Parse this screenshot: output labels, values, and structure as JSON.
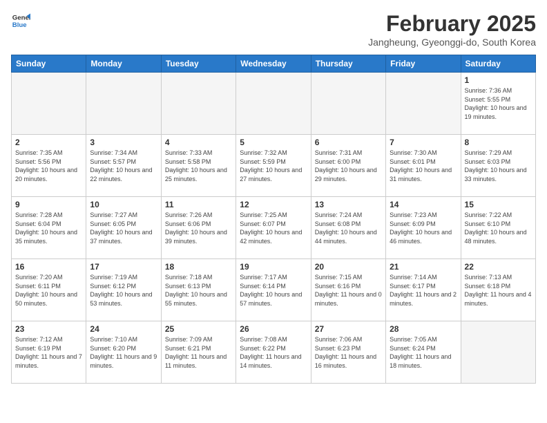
{
  "logo": {
    "general": "General",
    "blue": "Blue"
  },
  "title": "February 2025",
  "subtitle": "Jangheung, Gyeonggi-do, South Korea",
  "headers": [
    "Sunday",
    "Monday",
    "Tuesday",
    "Wednesday",
    "Thursday",
    "Friday",
    "Saturday"
  ],
  "weeks": [
    [
      {
        "day": "",
        "info": ""
      },
      {
        "day": "",
        "info": ""
      },
      {
        "day": "",
        "info": ""
      },
      {
        "day": "",
        "info": ""
      },
      {
        "day": "",
        "info": ""
      },
      {
        "day": "",
        "info": ""
      },
      {
        "day": "1",
        "info": "Sunrise: 7:36 AM\nSunset: 5:55 PM\nDaylight: 10 hours and 19 minutes."
      }
    ],
    [
      {
        "day": "2",
        "info": "Sunrise: 7:35 AM\nSunset: 5:56 PM\nDaylight: 10 hours and 20 minutes."
      },
      {
        "day": "3",
        "info": "Sunrise: 7:34 AM\nSunset: 5:57 PM\nDaylight: 10 hours and 22 minutes."
      },
      {
        "day": "4",
        "info": "Sunrise: 7:33 AM\nSunset: 5:58 PM\nDaylight: 10 hours and 25 minutes."
      },
      {
        "day": "5",
        "info": "Sunrise: 7:32 AM\nSunset: 5:59 PM\nDaylight: 10 hours and 27 minutes."
      },
      {
        "day": "6",
        "info": "Sunrise: 7:31 AM\nSunset: 6:00 PM\nDaylight: 10 hours and 29 minutes."
      },
      {
        "day": "7",
        "info": "Sunrise: 7:30 AM\nSunset: 6:01 PM\nDaylight: 10 hours and 31 minutes."
      },
      {
        "day": "8",
        "info": "Sunrise: 7:29 AM\nSunset: 6:03 PM\nDaylight: 10 hours and 33 minutes."
      }
    ],
    [
      {
        "day": "9",
        "info": "Sunrise: 7:28 AM\nSunset: 6:04 PM\nDaylight: 10 hours and 35 minutes."
      },
      {
        "day": "10",
        "info": "Sunrise: 7:27 AM\nSunset: 6:05 PM\nDaylight: 10 hours and 37 minutes."
      },
      {
        "day": "11",
        "info": "Sunrise: 7:26 AM\nSunset: 6:06 PM\nDaylight: 10 hours and 39 minutes."
      },
      {
        "day": "12",
        "info": "Sunrise: 7:25 AM\nSunset: 6:07 PM\nDaylight: 10 hours and 42 minutes."
      },
      {
        "day": "13",
        "info": "Sunrise: 7:24 AM\nSunset: 6:08 PM\nDaylight: 10 hours and 44 minutes."
      },
      {
        "day": "14",
        "info": "Sunrise: 7:23 AM\nSunset: 6:09 PM\nDaylight: 10 hours and 46 minutes."
      },
      {
        "day": "15",
        "info": "Sunrise: 7:22 AM\nSunset: 6:10 PM\nDaylight: 10 hours and 48 minutes."
      }
    ],
    [
      {
        "day": "16",
        "info": "Sunrise: 7:20 AM\nSunset: 6:11 PM\nDaylight: 10 hours and 50 minutes."
      },
      {
        "day": "17",
        "info": "Sunrise: 7:19 AM\nSunset: 6:12 PM\nDaylight: 10 hours and 53 minutes."
      },
      {
        "day": "18",
        "info": "Sunrise: 7:18 AM\nSunset: 6:13 PM\nDaylight: 10 hours and 55 minutes."
      },
      {
        "day": "19",
        "info": "Sunrise: 7:17 AM\nSunset: 6:14 PM\nDaylight: 10 hours and 57 minutes."
      },
      {
        "day": "20",
        "info": "Sunrise: 7:15 AM\nSunset: 6:16 PM\nDaylight: 11 hours and 0 minutes."
      },
      {
        "day": "21",
        "info": "Sunrise: 7:14 AM\nSunset: 6:17 PM\nDaylight: 11 hours and 2 minutes."
      },
      {
        "day": "22",
        "info": "Sunrise: 7:13 AM\nSunset: 6:18 PM\nDaylight: 11 hours and 4 minutes."
      }
    ],
    [
      {
        "day": "23",
        "info": "Sunrise: 7:12 AM\nSunset: 6:19 PM\nDaylight: 11 hours and 7 minutes."
      },
      {
        "day": "24",
        "info": "Sunrise: 7:10 AM\nSunset: 6:20 PM\nDaylight: 11 hours and 9 minutes."
      },
      {
        "day": "25",
        "info": "Sunrise: 7:09 AM\nSunset: 6:21 PM\nDaylight: 11 hours and 11 minutes."
      },
      {
        "day": "26",
        "info": "Sunrise: 7:08 AM\nSunset: 6:22 PM\nDaylight: 11 hours and 14 minutes."
      },
      {
        "day": "27",
        "info": "Sunrise: 7:06 AM\nSunset: 6:23 PM\nDaylight: 11 hours and 16 minutes."
      },
      {
        "day": "28",
        "info": "Sunrise: 7:05 AM\nSunset: 6:24 PM\nDaylight: 11 hours and 18 minutes."
      },
      {
        "day": "",
        "info": ""
      }
    ]
  ]
}
